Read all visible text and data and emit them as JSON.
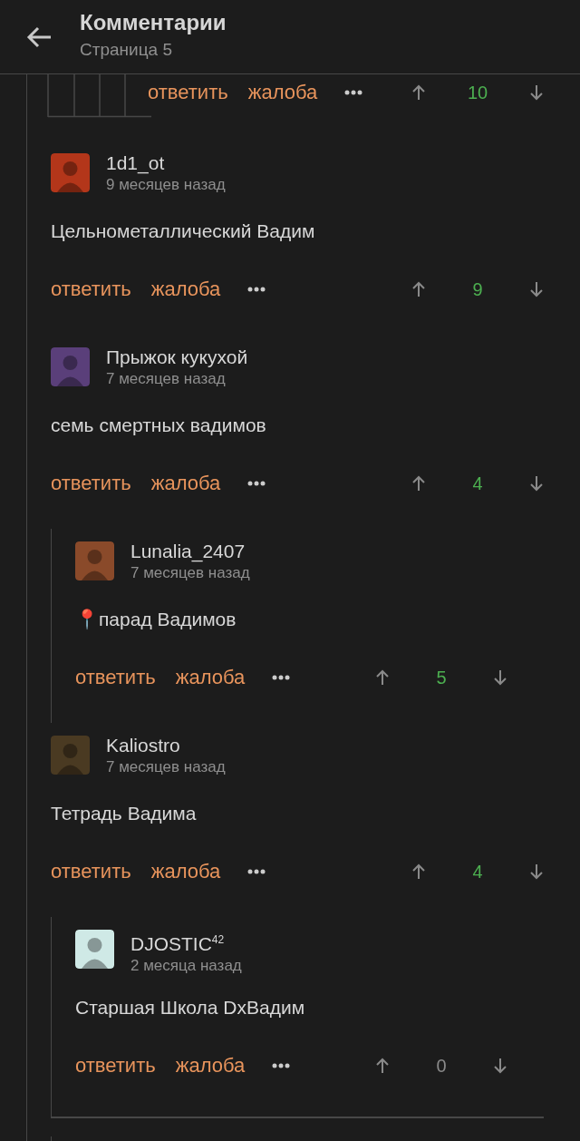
{
  "header": {
    "title": "Комментарии",
    "subtitle": "Страница 5"
  },
  "partial_comment": {
    "reply": "ответить",
    "report": "жалоба",
    "score": {
      "value": "10",
      "color": "#4caf50"
    }
  },
  "comments": [
    {
      "author": "1d1_ot",
      "time": "9 месяцев назад",
      "text": "Цельнометаллический Вадим",
      "avatar": {
        "color": "#b3361a"
      },
      "reply": "ответить",
      "report": "жалоба",
      "score": {
        "value": "9",
        "color": "#4caf50"
      },
      "bottom_rule": false
    },
    {
      "author": "Прыжок кукухой",
      "time": "7 месяцев назад",
      "text": "семь смертных вадимов",
      "avatar": {
        "color": "#5a3f7a"
      },
      "reply": "ответить",
      "report": "жалоба",
      "score": {
        "value": "4",
        "color": "#4caf50"
      },
      "bottom_rule": false,
      "children": [
        {
          "author": "Lunalia_2407",
          "time": "7 месяцев назад",
          "text": "📍парад Вадимов",
          "avatar": {
            "color": "#8a4a2a"
          },
          "reply": "ответить",
          "report": "жалоба",
          "score": {
            "value": "5",
            "color": "#4caf50"
          },
          "bottom_rule": false
        }
      ]
    },
    {
      "author": "Kaliostro",
      "time": "7 месяцев назад",
      "text": "Тетрадь Вадима",
      "avatar": {
        "color": "#4a3a22"
      },
      "reply": "ответить",
      "report": "жалоба",
      "score": {
        "value": "4",
        "color": "#4caf50"
      },
      "bottom_rule": false,
      "children": [
        {
          "author": "DJOSTIC$^{42}$",
          "time": "2 месяца назад",
          "text": "Старшая Школа DxВадим",
          "avatar": {
            "color": "#cfe9e6"
          },
          "reply": "ответить",
          "report": "жалоба",
          "score": {
            "value": "0",
            "color": "#8a8a8a"
          },
          "bottom_rule": true
        }
      ]
    }
  ]
}
